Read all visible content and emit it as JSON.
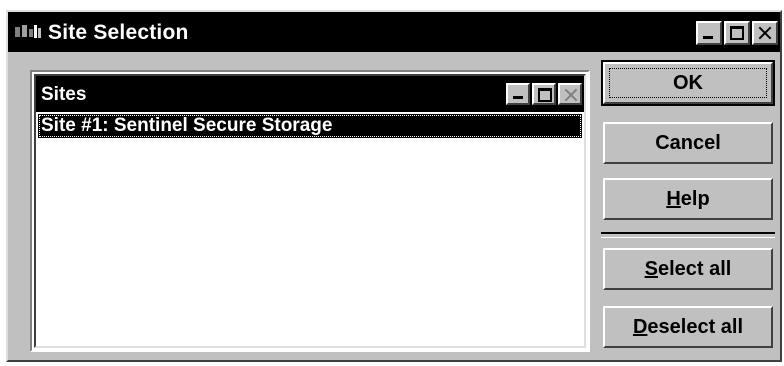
{
  "window": {
    "title": "Site Selection",
    "icon": "app-icon",
    "controls": [
      "minimize-icon",
      "maximize-icon",
      "close-icon"
    ]
  },
  "sites_panel": {
    "title": "Sites",
    "items": [
      {
        "label": "Site #1: Sentinel Secure Storage",
        "selected": true
      }
    ]
  },
  "buttons": {
    "ok": {
      "label": "OK"
    },
    "cancel": {
      "label": "Cancel"
    },
    "help": {
      "mnemonic": "H",
      "rest": "elp"
    },
    "select_all": {
      "mnemonic": "S",
      "rest": "elect all"
    },
    "deselect_all": {
      "mnemonic": "D",
      "rest": "eselect all"
    }
  },
  "colors": {
    "face": "#c0c0c0",
    "titlebar": "#000000",
    "selection": "#000000"
  }
}
